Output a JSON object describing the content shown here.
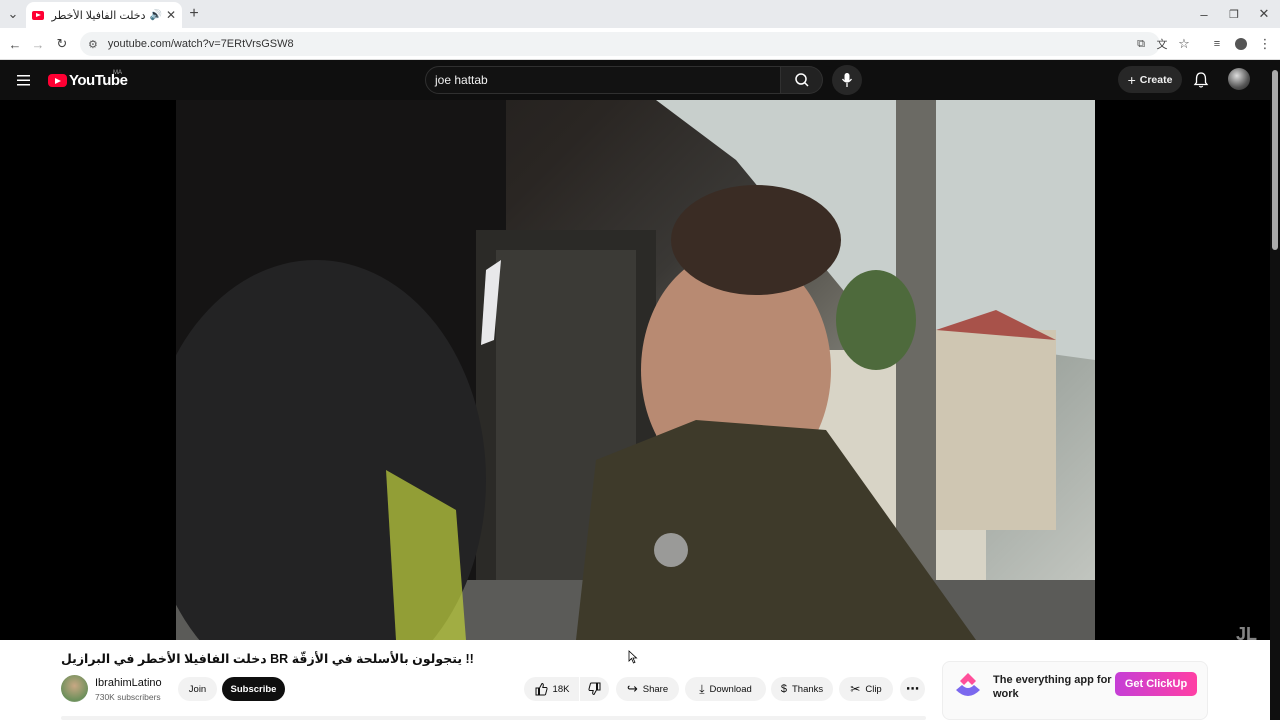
{
  "browser": {
    "tab_title": "دخلت الفافيلا الأخطر في البرا",
    "url": "youtube.com/watch?v=7ERtVrsGSW8",
    "audio_icon": "speaker-icon"
  },
  "youtube": {
    "logo_text": "YouTube",
    "country_code": "MA",
    "search_value": "joe hattab",
    "create_label": "Create"
  },
  "video": {
    "title": "!! يتجولون بالأسلحة في الأزقّة BR دخلت الفافيلا الأخطر في البرازيل",
    "watermark": "JL"
  },
  "channel": {
    "name": "IbrahimLatino",
    "subscribers": "730K subscribers",
    "join_label": "Join",
    "subscribe_label": "Subscribe"
  },
  "actions": {
    "likes": "18K",
    "share": "Share",
    "download": "Download",
    "thanks": "Thanks",
    "clip": "Clip"
  },
  "ad": {
    "headline": "The everything app for work",
    "cta": "Get ClickUp"
  },
  "colors": {
    "youtube_red": "#ff0033",
    "dark_bg": "#0f0f0f",
    "ad_cta": "#e247b8"
  }
}
